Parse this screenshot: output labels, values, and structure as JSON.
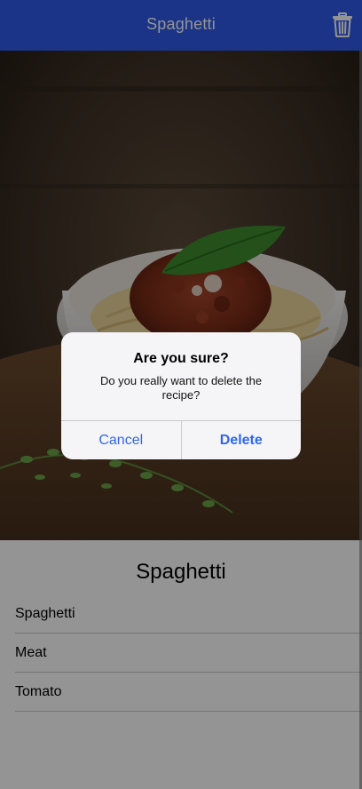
{
  "navbar": {
    "title": "Spaghetti",
    "delete_icon": "trash-icon",
    "background_color": "#2f5be8"
  },
  "hero": {
    "image_name": "spaghetti-photo"
  },
  "recipe": {
    "title": "Spaghetti",
    "ingredients": [
      "Spaghetti",
      "Meat",
      "Tomato"
    ]
  },
  "alert": {
    "title": "Are you sure?",
    "message": "Do you really want to delete the recipe?",
    "cancel_label": "Cancel",
    "delete_label": "Delete",
    "accent_color": "#2f66f0"
  }
}
